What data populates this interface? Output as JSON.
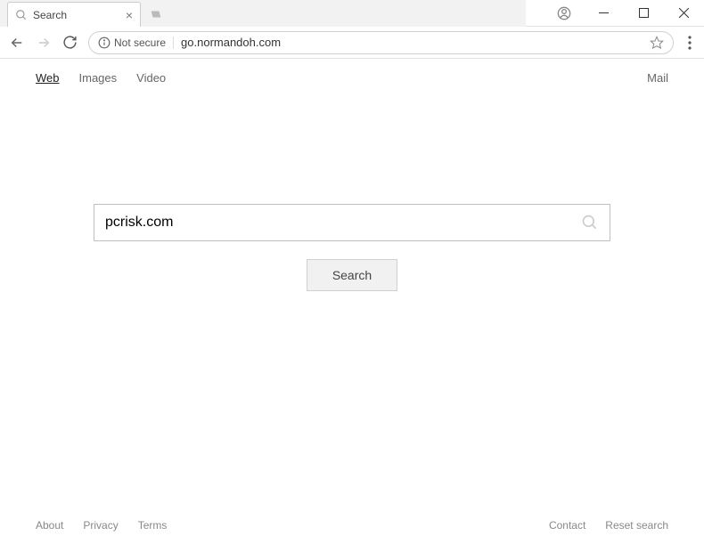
{
  "window": {
    "tab_title": "Search"
  },
  "toolbar": {
    "security_label": "Not secure",
    "url": "go.normandoh.com"
  },
  "nav": {
    "web": "Web",
    "images": "Images",
    "video": "Video",
    "mail": "Mail"
  },
  "search": {
    "input_value": "pcrisk.com",
    "placeholder": "",
    "button_label": "Search"
  },
  "footer": {
    "about": "About",
    "privacy": "Privacy",
    "terms": "Terms",
    "contact": "Contact",
    "reset": "Reset search"
  }
}
